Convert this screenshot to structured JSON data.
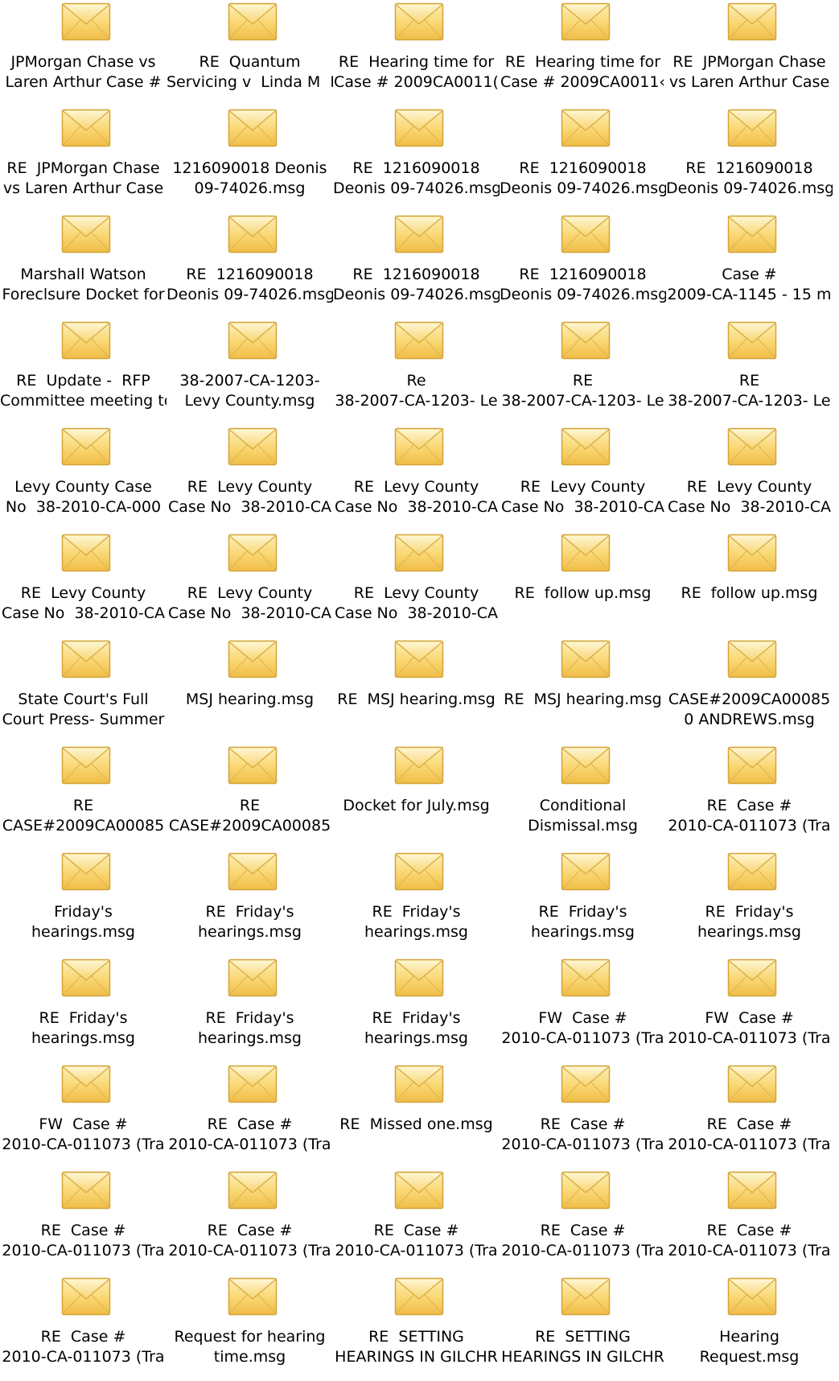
{
  "folder": {
    "view": "large-icons",
    "icon_name": "envelope-icon",
    "colors": {
      "background": "#ffffff",
      "text": "#000000",
      "envelope_fill": "#f9d671",
      "envelope_stroke": "#d3a43a"
    },
    "items": [
      {
        "line1": "JPMorgan Chase vs",
        "line2": "Laren Arthur Case #"
      },
      {
        "line1": "RE  Quantum",
        "line2": "Servicing v  Linda M  F"
      },
      {
        "line1": "RE  Hearing time for",
        "line2": "Case # 2009CA0011("
      },
      {
        "line1": "RE  Hearing time for",
        "line2": "Case # 2009CA0011‹"
      },
      {
        "line1": "RE  JPMorgan Chase",
        "line2": "vs Laren Arthur Case"
      },
      {
        "line1": "RE  JPMorgan Chase",
        "line2": "vs Laren Arthur Case"
      },
      {
        "line1": "1216090018 Deonis",
        "line2": "09-74026.msg"
      },
      {
        "line1": "RE  1216090018",
        "line2": "Deonis 09-74026.msg"
      },
      {
        "line1": "RE  1216090018",
        "line2": "Deonis 09-74026.msg"
      },
      {
        "line1": "RE  1216090018",
        "line2": "Deonis 09-74026.msg"
      },
      {
        "line1": "Marshall Watson",
        "line2": "Foreclsure Docket for"
      },
      {
        "line1": "RE  1216090018",
        "line2": "Deonis 09-74026.msg"
      },
      {
        "line1": "RE  1216090018",
        "line2": "Deonis 09-74026.msg"
      },
      {
        "line1": "RE  1216090018",
        "line2": "Deonis 09-74026.msg"
      },
      {
        "line1": "Case #",
        "line2": "2009-CA-1145 - 15 m"
      },
      {
        "line1": "RE  Update -  RFP",
        "line2": "Committee meeting to"
      },
      {
        "line1": "38-2007-CA-1203-",
        "line2": "Levy County.msg"
      },
      {
        "line1": "Re",
        "line2": "38-2007-CA-1203- Le"
      },
      {
        "line1": "RE",
        "line2": "38-2007-CA-1203- Le"
      },
      {
        "line1": "RE",
        "line2": "38-2007-CA-1203- Le"
      },
      {
        "line1": "Levy County Case",
        "line2": "No  38-2010-CA-000"
      },
      {
        "line1": "RE  Levy County",
        "line2": "Case No  38-2010-CA"
      },
      {
        "line1": "RE  Levy County",
        "line2": "Case No  38-2010-CA"
      },
      {
        "line1": "RE  Levy County",
        "line2": "Case No  38-2010-CA"
      },
      {
        "line1": "RE  Levy County",
        "line2": "Case No  38-2010-CA"
      },
      {
        "line1": "RE  Levy County",
        "line2": "Case No  38-2010-CA"
      },
      {
        "line1": "RE  Levy County",
        "line2": "Case No  38-2010-CA"
      },
      {
        "line1": "RE  Levy County",
        "line2": "Case No  38-2010-CA"
      },
      {
        "line1": "RE  follow up.msg",
        "line2": ""
      },
      {
        "line1": "RE  follow up.msg",
        "line2": ""
      },
      {
        "line1": "State Court's Full",
        "line2": "Court Press- Summer"
      },
      {
        "line1": "MSJ hearing.msg",
        "line2": ""
      },
      {
        "line1": "RE  MSJ hearing.msg",
        "line2": ""
      },
      {
        "line1": "RE  MSJ hearing.msg",
        "line2": ""
      },
      {
        "line1": "CASE#2009CA00085",
        "line2": "0 ANDREWS.msg"
      },
      {
        "line1": "RE",
        "line2": "CASE#2009CA00085"
      },
      {
        "line1": "RE",
        "line2": "CASE#2009CA00085"
      },
      {
        "line1": "Docket for July.msg",
        "line2": ""
      },
      {
        "line1": "Conditional",
        "line2": "Dismissal.msg"
      },
      {
        "line1": "RE  Case #",
        "line2": "2010-CA-011073 (Tra"
      },
      {
        "line1": "Friday's",
        "line2": "hearings.msg"
      },
      {
        "line1": "RE  Friday's",
        "line2": "hearings.msg"
      },
      {
        "line1": "RE  Friday's",
        "line2": "hearings.msg"
      },
      {
        "line1": "RE  Friday's",
        "line2": "hearings.msg"
      },
      {
        "line1": "RE  Friday's",
        "line2": "hearings.msg"
      },
      {
        "line1": "RE  Friday's",
        "line2": "hearings.msg"
      },
      {
        "line1": "RE  Friday's",
        "line2": "hearings.msg"
      },
      {
        "line1": "RE  Friday's",
        "line2": "hearings.msg"
      },
      {
        "line1": "FW  Case #",
        "line2": "2010-CA-011073 (Tra"
      },
      {
        "line1": "FW  Case #",
        "line2": "2010-CA-011073 (Tra"
      },
      {
        "line1": "FW  Case #",
        "line2": "2010-CA-011073 (Tra"
      },
      {
        "line1": "RE  Case #",
        "line2": "2010-CA-011073 (Tra"
      },
      {
        "line1": "RE  Missed one.msg",
        "line2": ""
      },
      {
        "line1": "RE  Case #",
        "line2": "2010-CA-011073 (Tra"
      },
      {
        "line1": "RE  Case #",
        "line2": "2010-CA-011073 (Tra"
      },
      {
        "line1": "RE  Case #",
        "line2": "2010-CA-011073 (Tra"
      },
      {
        "line1": "RE  Case #",
        "line2": "2010-CA-011073 (Tra"
      },
      {
        "line1": "RE  Case #",
        "line2": "2010-CA-011073 (Tra"
      },
      {
        "line1": "RE  Case #",
        "line2": "2010-CA-011073 (Tra"
      },
      {
        "line1": "RE  Case #",
        "line2": "2010-CA-011073 (Tra"
      },
      {
        "line1": "RE  Case #",
        "line2": "2010-CA-011073 (Tra"
      },
      {
        "line1": "Request for hearing",
        "line2": "time.msg"
      },
      {
        "line1": "RE  SETTING",
        "line2": "HEARINGS IN GILCHR"
      },
      {
        "line1": "RE  SETTING",
        "line2": "HEARINGS IN GILCHR"
      },
      {
        "line1": "Hearing",
        "line2": "Request.msg"
      }
    ]
  }
}
